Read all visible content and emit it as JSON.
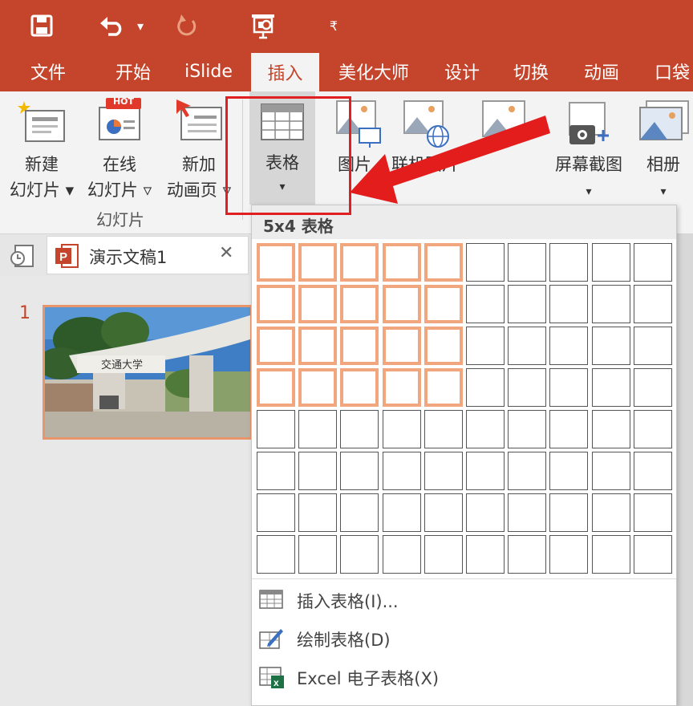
{
  "quick_access": {
    "save_icon": "save-icon",
    "undo_icon": "undo-icon",
    "undo_dropdown": "▾",
    "redo_icon": "redo-icon",
    "present_icon": "start-from-beginning-icon",
    "customize": "₹"
  },
  "tabs": [
    {
      "label": "文件"
    },
    {
      "label": "开始"
    },
    {
      "label": "iSlide"
    },
    {
      "label": "插入"
    },
    {
      "label": "美化大师"
    },
    {
      "label": "设计"
    },
    {
      "label": "切换"
    },
    {
      "label": "动画"
    },
    {
      "label": "口袋"
    }
  ],
  "ribbon": {
    "new_slide": {
      "line1": "新建",
      "line2": "幻灯片 ▾"
    },
    "online_slide": {
      "line1": "在线",
      "line2": "幻灯片 ▿",
      "badge": "HOT"
    },
    "add_anim": {
      "line1": "新加",
      "line2": "动画页 ▿"
    },
    "table": {
      "label": "表格",
      "arrow": "▾"
    },
    "picture": {
      "label": "图片"
    },
    "online_picture": {
      "label": "联机图片"
    },
    "screenshot": {
      "label": "屏幕截图",
      "arrow": "▾"
    },
    "album": {
      "label": "相册",
      "arrow": "▾"
    },
    "group_label": "幻灯片"
  },
  "document": {
    "tab_name": "演示文稿1",
    "close": "✕",
    "slide_number": "1",
    "thumb_text": "交通大学"
  },
  "dropdown": {
    "title": "5x4 表格",
    "grid_cols": 10,
    "grid_rows": 8,
    "selected_cols": 5,
    "selected_rows": 4,
    "items": [
      {
        "label": "插入表格(I)..."
      },
      {
        "label": "绘制表格(D)"
      },
      {
        "label": "Excel 电子表格(X)"
      }
    ]
  },
  "colors": {
    "accent": "#c4452b",
    "highlight": "#e02020",
    "grid_selected": "#f2a67e"
  }
}
